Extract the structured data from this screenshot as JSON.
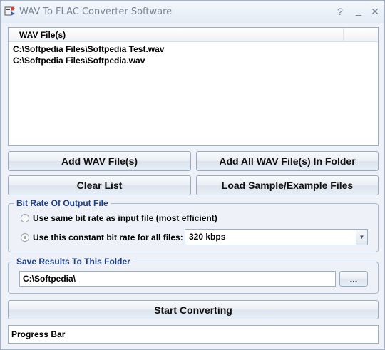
{
  "window": {
    "title": "WAV To FLAC Converter Software"
  },
  "filelist": {
    "column_header": "WAV File(s)",
    "items": [
      "C:\\Softpedia Files\\Softpedia Test.wav",
      "C:\\Softpedia Files\\Softpedia.wav"
    ]
  },
  "buttons": {
    "add_files": "Add WAV File(s)",
    "add_all_in_folder": "Add All WAV File(s) In Folder",
    "clear_list": "Clear List",
    "load_samples": "Load Sample/Example Files",
    "browse": "...",
    "start": "Start Converting"
  },
  "bitrate": {
    "legend": "Bit Rate Of Output File",
    "option_same": "Use same bit rate as input file (most efficient)",
    "option_constant": "Use this constant bit rate for all files:",
    "selected_option": "constant",
    "selected_value": "320 kbps"
  },
  "output": {
    "legend": "Save Results To This Folder",
    "folder": "C:\\Softpedia\\"
  },
  "status": {
    "progress_label": "Progress Bar"
  }
}
